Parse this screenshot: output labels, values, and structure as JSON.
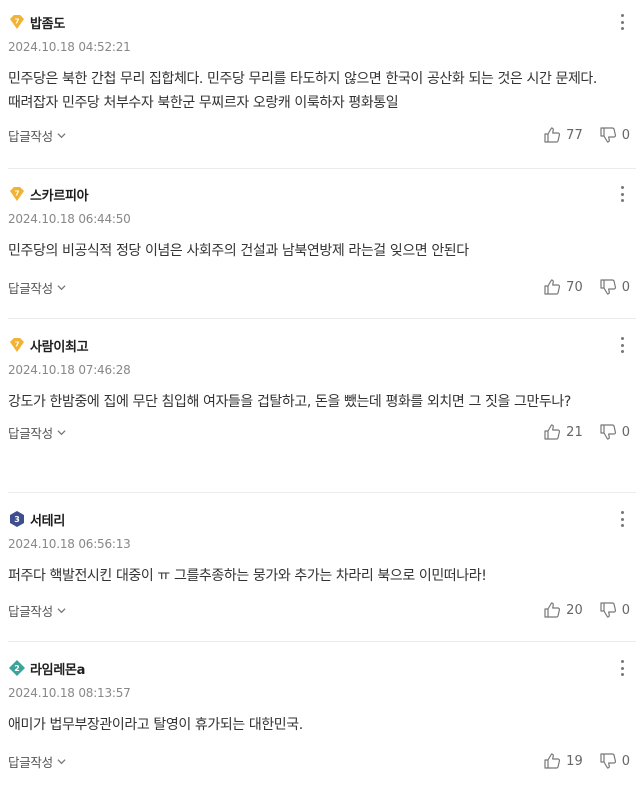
{
  "ui": {
    "reply_label": "답글작성"
  },
  "comments": [
    {
      "nickname": "밥좀도",
      "badge_level": "7",
      "badge_color": "#f2b233",
      "date": "2024.10.18 04:52:21",
      "text": "민주당은 북한 간첩 무리 집합체다. 민주당 무리를 타도하지 않으면 한국이 공산화 되는 것은 시간 문제다. 때려잡자 민주당 처부수자 북한군 무찌르자 오랑캐 이룩하자 평화통일",
      "likes": "77",
      "dislikes": "0"
    },
    {
      "nickname": "스카르피아",
      "badge_level": "7",
      "badge_color": "#f2b233",
      "date": "2024.10.18 06:44:50",
      "text": "민주당의 비공식적 정당 이념은 사회주의 건설과 남북연방제 라는걸 잊으면 안된다",
      "likes": "70",
      "dislikes": "0"
    },
    {
      "nickname": "사람이최고",
      "badge_level": "7",
      "badge_color": "#f2b233",
      "date": "2024.10.18 07:46:28",
      "text": "강도가 한밤중에 집에 무단 침입해 여자들을 겁탈하고, 돈을 뺐는데 평화를 외치면 그 짓을 그만두나?",
      "likes": "21",
      "dislikes": "0"
    },
    {
      "nickname": "서테리",
      "badge_level": "3",
      "badge_color": "#3f4e8c",
      "date": "2024.10.18 06:56:13",
      "text": "퍼주다 핵발전시킨 대중이 ㅠ 그를추종하는 뭉가와 추가는 차라리 북으로 이민떠나라!",
      "likes": "20",
      "dislikes": "0"
    },
    {
      "nickname": "라임레몬a",
      "badge_level": "2",
      "badge_color": "#3aa39a",
      "date": "2024.10.18 08:13:57",
      "text": "애미가 법무부장관이라고 탈영이 휴가되는 대한민국.",
      "likes": "19",
      "dislikes": "0"
    }
  ]
}
